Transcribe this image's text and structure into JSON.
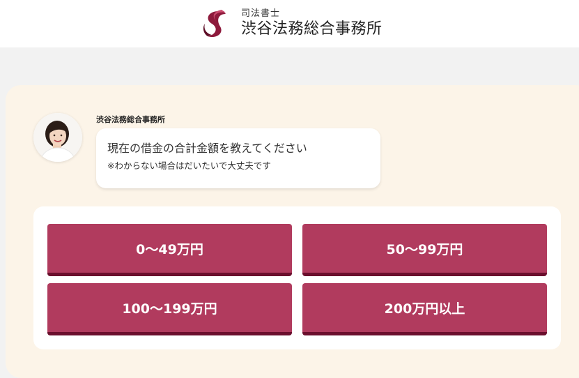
{
  "header": {
    "logo_subtitle": "司法書士",
    "logo_name": "渋谷法務総合事務所"
  },
  "chat": {
    "sender": "渋谷法務総合事務所",
    "question": "現在の借金の合計金額を教えてください",
    "note": "※わからない場合はだいたいで大丈夫です"
  },
  "options": [
    "0～49万円",
    "50～99万円",
    "100～199万円",
    "200万円以上"
  ],
  "colors": {
    "brand": "#b13b5e",
    "brand_dark": "#6b0f2d",
    "panel_bg": "#fcf4e8",
    "page_bg": "#f2f2f2"
  }
}
